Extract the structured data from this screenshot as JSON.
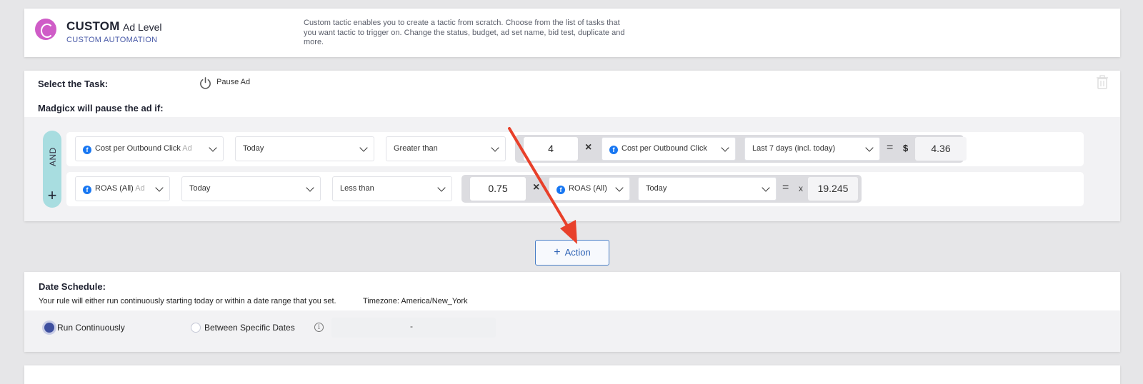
{
  "header": {
    "title": "CUSTOM",
    "level": "Ad Level",
    "subtitle": "CUSTOM AUTOMATION",
    "description": "Custom tactic enables you to create a tactic from scratch. Choose from the list of tasks that you want tactic to trigger on. Change the status, budget, ad set name, bid test, duplicate and more.",
    "logo_color": "#cf5cc7"
  },
  "task": {
    "select_label": "Select the Task:",
    "task_icon": "power-icon",
    "task_value": "Pause Ad",
    "condition_label": "Madgicx will pause the ad if:",
    "connector": "AND",
    "add_symbol": "+"
  },
  "conditions": [
    {
      "metric": "Cost per Outbound Click",
      "metric_level": "Ad",
      "period": "Today",
      "operator": "Greater than",
      "multiplier": "4",
      "times_symbol": "×",
      "compare_metric": "Cost per Outbound Click",
      "compare_period": "Last 7 days (incl. today)",
      "equals": "=",
      "result_prefix": "$",
      "result": "4.36"
    },
    {
      "metric": "ROAS (All)",
      "metric_level": "Ad",
      "period": "Today",
      "operator": "Less than",
      "multiplier": "0.75",
      "times_symbol": "×",
      "compare_metric": "ROAS (All)",
      "compare_period": "Today",
      "equals": "=",
      "result_prefix": "x",
      "result": "19.245"
    }
  ],
  "action_button": {
    "plus": "+",
    "label": "Action"
  },
  "date_schedule": {
    "title": "Date Schedule:",
    "description": "Your rule will either run continuously starting today or within a date range that you set.",
    "timezone": "Timezone: America/New_York",
    "options": [
      "Run Continuously",
      "Between Specific Dates"
    ],
    "selected": "Run Continuously",
    "range_separator": "-"
  },
  "colors": {
    "accent": "#3e4f9f",
    "facebook": "#1877f2",
    "and_pill": "#a8dde0",
    "arrow": "#e8402a"
  }
}
